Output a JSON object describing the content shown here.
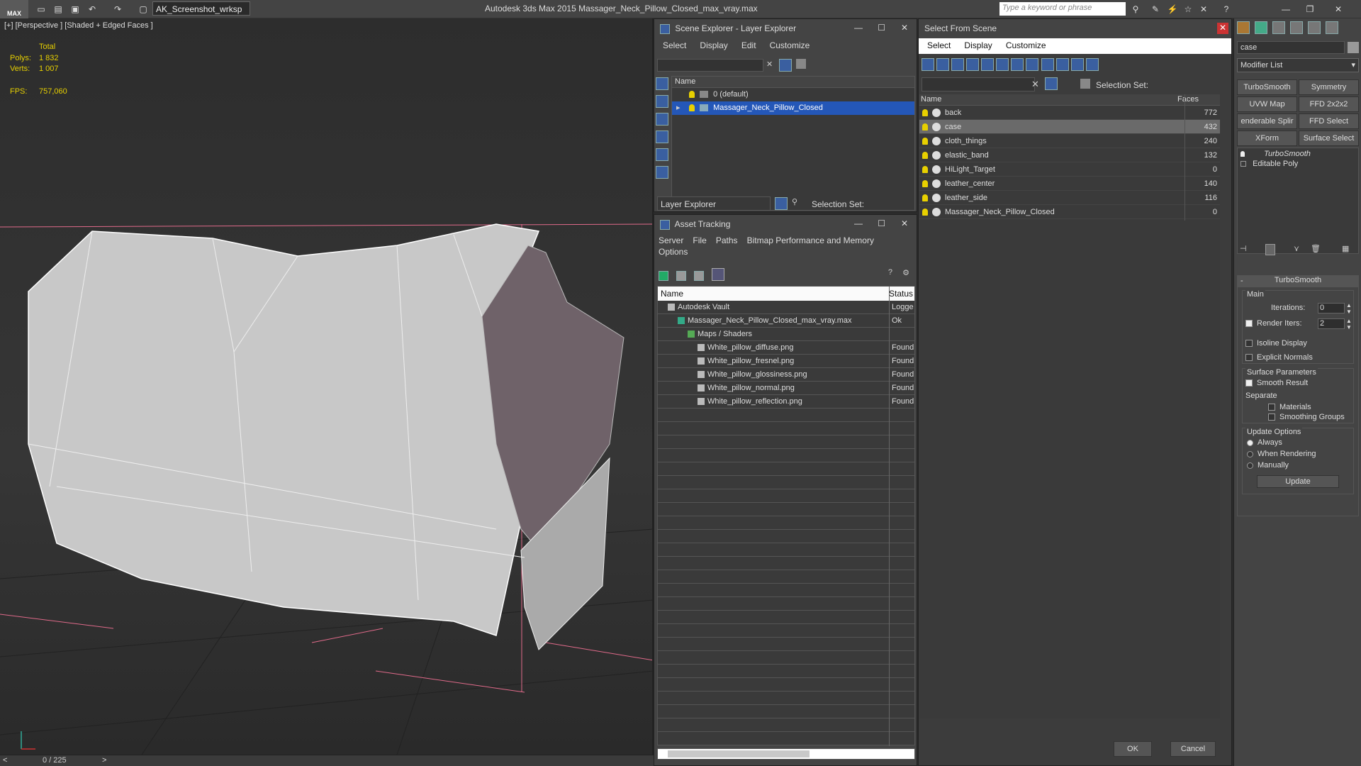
{
  "titlebar": {
    "logo": "MAX",
    "workspace": "AK_Screenshot_wrksp",
    "app_title": "Autodesk 3ds Max  2015     Massager_Neck_Pillow_Closed_max_vray.max",
    "search_placeholder": "Type a keyword or phrase"
  },
  "viewport": {
    "label": "[+] [Perspective ] [Shaded + Edged Faces ]",
    "stats": {
      "total_label": "Total",
      "polys_label": "Polys:",
      "polys": "1 832",
      "verts_label": "Verts:",
      "verts": "1 007",
      "fps_label": "FPS:",
      "fps": "757,060"
    },
    "timeline": "0 / 225"
  },
  "scene_explorer": {
    "title": "Scene Explorer - Layer Explorer",
    "menu": [
      "Select",
      "Display",
      "Edit",
      "Customize"
    ],
    "col_name": "Name",
    "layers": [
      {
        "name": "0 (default)",
        "selected": false
      },
      {
        "name": "Massager_Neck_Pillow_Closed",
        "selected": true
      }
    ],
    "footer_mode": "Layer Explorer",
    "selection_set_label": "Selection Set:"
  },
  "asset_tracking": {
    "title": "Asset Tracking",
    "menu": [
      "Server",
      "File",
      "Paths",
      "Bitmap Performance and Memory"
    ],
    "menu2": "Options",
    "cols": [
      "Name",
      "Status"
    ],
    "rows": [
      {
        "name": "Autodesk Vault",
        "status": "Logge",
        "indent": 0
      },
      {
        "name": "Massager_Neck_Pillow_Closed_max_vray.max",
        "status": "Ok",
        "indent": 1
      },
      {
        "name": "Maps / Shaders",
        "status": "",
        "indent": 2
      },
      {
        "name": "White_pillow_diffuse.png",
        "status": "Found",
        "indent": 3
      },
      {
        "name": "White_pillow_fresnel.png",
        "status": "Found",
        "indent": 3
      },
      {
        "name": "White_pillow_glossiness.png",
        "status": "Found",
        "indent": 3
      },
      {
        "name": "White_pillow_normal.png",
        "status": "Found",
        "indent": 3
      },
      {
        "name": "White_pillow_reflection.png",
        "status": "Found",
        "indent": 3
      }
    ]
  },
  "select_from_scene": {
    "title": "Select From Scene",
    "menu": [
      "Select",
      "Display",
      "Customize"
    ],
    "selection_set_label": "Selection Set:",
    "cols": [
      "Name",
      "Faces"
    ],
    "objects": [
      {
        "name": "back",
        "faces": "772",
        "selected": false
      },
      {
        "name": "case",
        "faces": "432",
        "selected": true
      },
      {
        "name": "cloth_things",
        "faces": "240",
        "selected": false
      },
      {
        "name": "elastic_band",
        "faces": "132",
        "selected": false
      },
      {
        "name": "HiLight_Target",
        "faces": "0",
        "selected": false
      },
      {
        "name": "leather_center",
        "faces": "140",
        "selected": false
      },
      {
        "name": "leather_side",
        "faces": "116",
        "selected": false
      },
      {
        "name": "Massager_Neck_Pillow_Closed",
        "faces": "0",
        "selected": false
      }
    ],
    "ok": "OK",
    "cancel": "Cancel"
  },
  "modify_panel": {
    "object_name": "case",
    "modifier_list": "Modifier List",
    "buttons": [
      "TurboSmooth",
      "Symmetry",
      "UVW Map",
      "FFD 2x2x2",
      "enderable Splir",
      "FFD Select",
      "XForm",
      "Surface Select"
    ],
    "stack": [
      "TurboSmooth",
      "Editable Poly"
    ],
    "rollout_title": "TurboSmooth",
    "main_label": "Main",
    "iterations_label": "Iterations:",
    "iterations": "0",
    "render_iters_label": "Render Iters:",
    "render_iters": "2",
    "isoline": "Isoline Display",
    "explicit_normals": "Explicit Normals",
    "surface_params": "Surface Parameters",
    "smooth_result": "Smooth Result",
    "separate": "Separate",
    "materials": "Materials",
    "smoothing_groups": "Smoothing Groups",
    "update_options": "Update Options",
    "always": "Always",
    "when_rendering": "When Rendering",
    "manually": "Manually",
    "update": "Update"
  }
}
